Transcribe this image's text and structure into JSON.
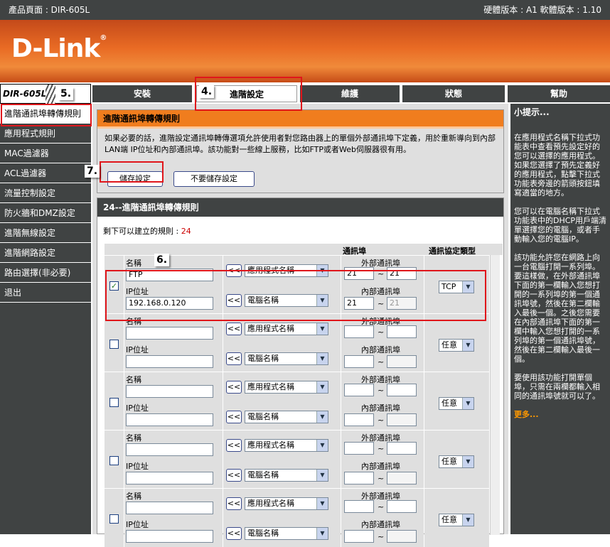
{
  "topbar": {
    "product": "產品頁面 : DIR-605L",
    "versions": "硬體版本 : A1  軟體版本 : 1.10"
  },
  "brand": {
    "logo": "D-Link"
  },
  "nav": {
    "model": "DIR-605L",
    "tabs": [
      "安裝",
      "進階設定",
      "維護",
      "狀態",
      "幫助"
    ],
    "active_tab": "進階設定"
  },
  "sidebar": {
    "items": [
      "進階通訊埠轉傳規則",
      "應用程式規則",
      "MAC過濾器",
      "ACL過濾器",
      "流量控制設定",
      "防火牆和DMZ設定",
      "進階無線設定",
      "進階網路設定",
      "路由選擇(非必要)",
      "退出"
    ]
  },
  "section1": {
    "title": "進階通訊埠轉傳規則",
    "description": "如果必要的話，進階設定通訊埠轉傳選項允許使用者對您路由器上的單個外部通訊埠下定義，用於重新導向到內部LAN端 IP位址和內部通訊埠。該功能對一些線上服務，比如FTP或者Web伺服器很有用。",
    "save_label": "儲存設定",
    "nosave_label": "不要儲存設定"
  },
  "section2": {
    "title": "24--進階通訊埠轉傳規則",
    "remaining_label": "剩下可以建立的規則 : ",
    "remaining_value": "24",
    "col_port": "通訊埠",
    "col_proto": "通訊協定類型",
    "name_label": "名稱",
    "ip_label": "IP位址",
    "app_name_option": "應用程式名稱",
    "pc_name_option": "電腦名稱",
    "ext_port_label": "外部通訊埠",
    "int_port_label": "內部通訊埠",
    "arrow_label": "<<",
    "tilde": "~",
    "rules": [
      {
        "checked": true,
        "name": "FTP",
        "ip": "192.168.0.120",
        "ext_start": "21",
        "ext_end": "21",
        "int_start": "21",
        "int_end": "21",
        "proto": "TCP"
      },
      {
        "checked": false,
        "name": "",
        "ip": "",
        "ext_start": "",
        "ext_end": "",
        "int_start": "",
        "int_end": "",
        "proto": "任意"
      },
      {
        "checked": false,
        "name": "",
        "ip": "",
        "ext_start": "",
        "ext_end": "",
        "int_start": "",
        "int_end": "",
        "proto": "任意"
      },
      {
        "checked": false,
        "name": "",
        "ip": "",
        "ext_start": "",
        "ext_end": "",
        "int_start": "",
        "int_end": "",
        "proto": "任意"
      },
      {
        "checked": false,
        "name": "",
        "ip": "",
        "ext_start": "",
        "ext_end": "",
        "int_start": "",
        "int_end": "",
        "proto": "任意"
      }
    ]
  },
  "hints": {
    "title": "小提示...",
    "p1": "在應用程式名稱下拉式功能表中查看預先設定好的您可以選擇的應用程式。如果您選擇了預先定義好的應用程式，點擊下拉式功能表旁邊的箭頭按鈕填寫適當的地方。",
    "p2": "您可以在電腦名稱下拉式功能表中的DHCP用戶端清單選擇您的電腦，或者手動輸入您的電腦IP。",
    "p3": "該功能允許您在網路上向一台電腦打開一系列埠。要這樣做，在外部通訊埠下面的第一欄輸入您想打開的一系列埠的第一個通訊埠號，然後在第二欄輸入最後一個。之後您需要在內部通訊埠下面的第一欄中輸入您想打開的一系列埠的第一個通訊埠號，然後在第二欄輸入最後一個。",
    "p4": "要使用該功能打開單個埠，只需在兩欄都輸入相同的通訊埠號就可以了。",
    "more": "更多..."
  },
  "callouts": {
    "c4": "4.",
    "c5": "5.",
    "c6": "6.",
    "c7": "7."
  }
}
